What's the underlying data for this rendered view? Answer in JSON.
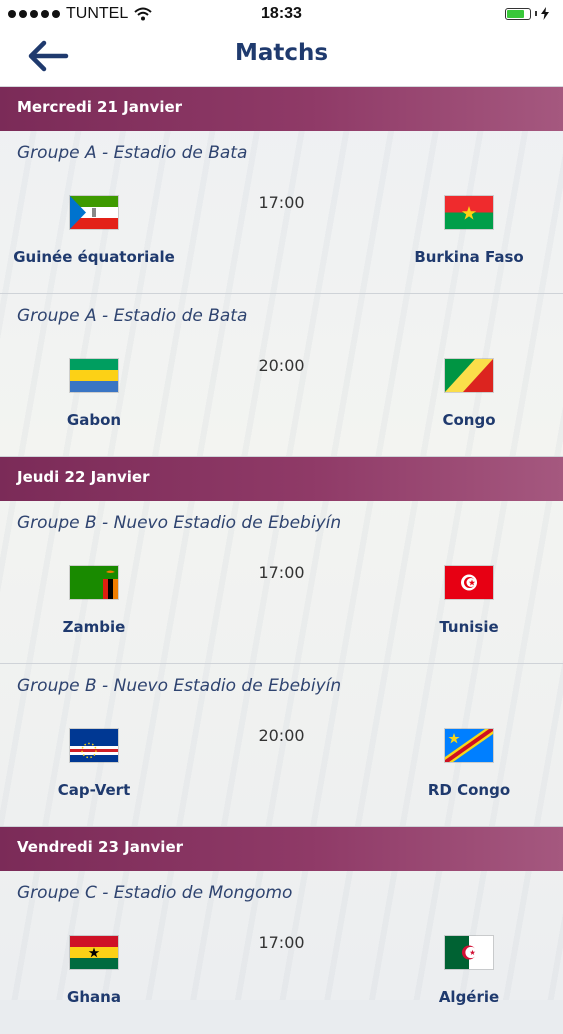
{
  "status_bar": {
    "carrier": "TUNTEL",
    "time": "18:33",
    "icons": [
      "signal-dots-icon",
      "wifi-icon",
      "battery-icon",
      "charging-bolt-icon"
    ],
    "battery_level": 0.72,
    "battery_color": "#39c83a"
  },
  "nav": {
    "title": "Matchs",
    "back_icon": "arrow-left-icon",
    "title_color": "#1f3a6e"
  },
  "colors": {
    "day_header": "#8a365f",
    "team_text": "#1f3a6e"
  },
  "days": [
    {
      "label": "Mercredi 21 Janvier",
      "matches": [
        {
          "group": "Groupe A - Estadio de Bata",
          "time": "17:00",
          "home": {
            "name": "Guinée équatoriale",
            "flag": "equatorial-guinea-flag-icon"
          },
          "away": {
            "name": "Burkina Faso",
            "flag": "burkina-faso-flag-icon"
          }
        },
        {
          "group": "Groupe A - Estadio de Bata",
          "time": "20:00",
          "home": {
            "name": "Gabon",
            "flag": "gabon-flag-icon"
          },
          "away": {
            "name": "Congo",
            "flag": "congo-flag-icon"
          }
        }
      ]
    },
    {
      "label": "Jeudi 22 Janvier",
      "matches": [
        {
          "group": "Groupe B - Nuevo Estadio de Ebebiyín",
          "time": "17:00",
          "home": {
            "name": "Zambie",
            "flag": "zambia-flag-icon"
          },
          "away": {
            "name": "Tunisie",
            "flag": "tunisia-flag-icon"
          }
        },
        {
          "group": "Groupe B - Nuevo Estadio de Ebebiyín",
          "time": "20:00",
          "home": {
            "name": "Cap-Vert",
            "flag": "cape-verde-flag-icon"
          },
          "away": {
            "name": "RD Congo",
            "flag": "dr-congo-flag-icon"
          }
        }
      ]
    },
    {
      "label": "Vendredi 23 Janvier",
      "matches": [
        {
          "group": "Groupe C - Estadio de Mongomo",
          "time": "17:00",
          "home": {
            "name": "Ghana",
            "flag": "ghana-flag-icon"
          },
          "away": {
            "name": "Algérie",
            "flag": "algeria-flag-icon"
          }
        }
      ]
    }
  ]
}
